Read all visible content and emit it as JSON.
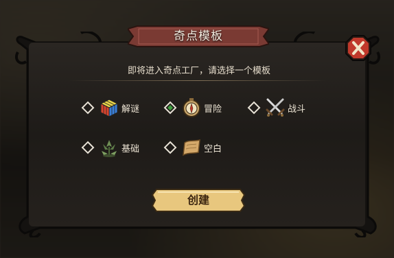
{
  "dialog": {
    "title": "奇点模板",
    "subtitle": "即将进入奇点工厂，请选择一个模板",
    "create_label": "创建"
  },
  "templates": [
    {
      "label": "解谜",
      "icon": "rubiks-cube-icon",
      "selected": false
    },
    {
      "label": "冒险",
      "icon": "compass-icon",
      "selected": true
    },
    {
      "label": "战斗",
      "icon": "crossed-swords-icon",
      "selected": false
    },
    {
      "label": "基础",
      "icon": "plant-icon",
      "selected": false
    },
    {
      "label": "空白",
      "icon": "parchment-icon",
      "selected": false
    }
  ],
  "colors": {
    "title_banner": "#7a3a33",
    "accent_selected": "#3f9e3f",
    "close_button": "#c0392b",
    "create_button": "#e8c77e"
  }
}
